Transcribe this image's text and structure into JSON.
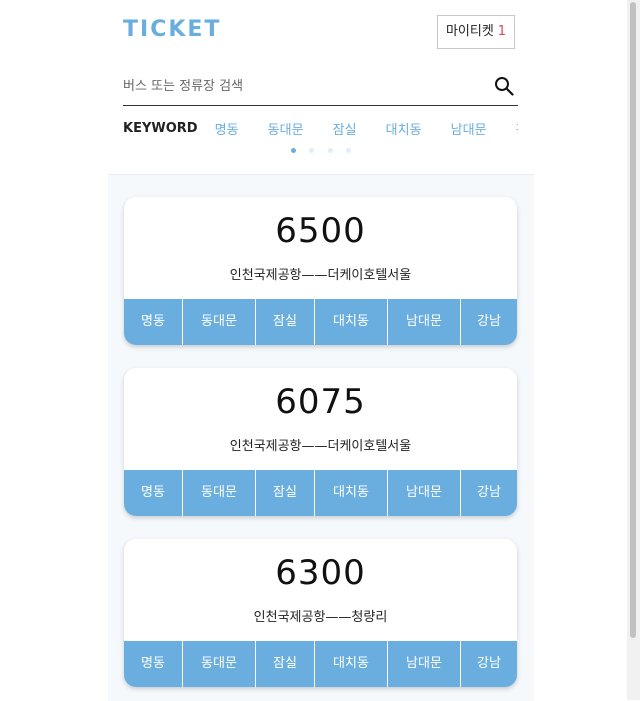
{
  "header": {
    "logo": "TICKET",
    "my_ticket": {
      "label": "마이티켓",
      "count": "1"
    }
  },
  "search": {
    "placeholder": "버스 또는 정류장 검색",
    "value": "",
    "icon": "search-icon"
  },
  "keywords": {
    "label": "KEYWORD",
    "items": [
      "명동",
      "동대문",
      "잠실",
      "대치동",
      "남대문",
      "강남"
    ],
    "pages": 4,
    "active_page": 1
  },
  "routes": [
    {
      "number": "6500",
      "route": "인천국제공항——더케이호텔서울",
      "stops": [
        "명동",
        "동대문",
        "잠실",
        "대치동",
        "남대문",
        "강남"
      ]
    },
    {
      "number": "6075",
      "route": "인천국제공항——더케이호텔서울",
      "stops": [
        "명동",
        "동대문",
        "잠실",
        "대치동",
        "남대문",
        "강남"
      ]
    },
    {
      "number": "6300",
      "route": "인천국제공항——청량리",
      "stops": [
        "명동",
        "동대문",
        "잠실",
        "대치동",
        "남대문",
        "강남"
      ]
    }
  ],
  "colors": {
    "accent": "#6aaee0",
    "badge": "#e0445a",
    "list_bg": "#f5f9fc"
  }
}
